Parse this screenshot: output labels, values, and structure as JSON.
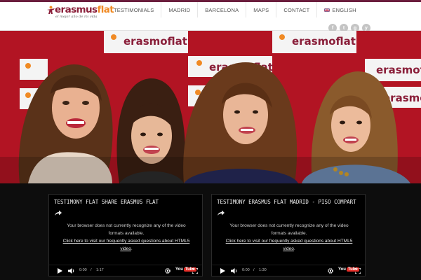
{
  "brand": {
    "logo_main": "erasmus",
    "logo_accent": "flat",
    "tagline": "el mejor año de mi vida",
    "hero_banner_text": "erasmoflat",
    "colors": {
      "primary": "#8a1f3a",
      "accent": "#f08a24",
      "hero_wall": "#b01224"
    }
  },
  "nav": {
    "items": [
      "TESTIMONIALS",
      "MADRID",
      "BARCELONA",
      "MAPS",
      "CONTACT"
    ],
    "language": {
      "label": "ENGLISH",
      "icon": "uk-flag-icon"
    }
  },
  "socials": [
    {
      "icon": "facebook-icon",
      "glyph": "f"
    },
    {
      "icon": "twitter-icon",
      "glyph": "t"
    },
    {
      "icon": "google-plus-icon",
      "glyph": "g"
    },
    {
      "icon": "youtube-icon",
      "glyph": "y"
    }
  ],
  "videos": [
    {
      "title": "TESTIMONY FLAT SHARE ERASMUS FLAT",
      "message_line1": "Your browser does not currently recognize any of the video",
      "message_line2": "formats available.",
      "link_line1": "Click here to visit our frequently asked questions about HTML5",
      "link_line2": "video",
      "link_end": ".",
      "current_time": "0:00",
      "separator": "/",
      "duration": "1:17",
      "brand_a": "You",
      "brand_b": "Tube"
    },
    {
      "title": "TESTIMONY ERASMUS FLAT MADRID - PISO COMPART",
      "message_line1": "Your browser does not currently recognize any of the video",
      "message_line2": "formats available.",
      "link_line1": "Click here to visit our frequently asked questions about HTML5",
      "link_line2": "video",
      "link_end": ".",
      "current_time": "0:00",
      "separator": "/",
      "duration": "1:30",
      "brand_a": "You",
      "brand_b": "Tube"
    }
  ]
}
